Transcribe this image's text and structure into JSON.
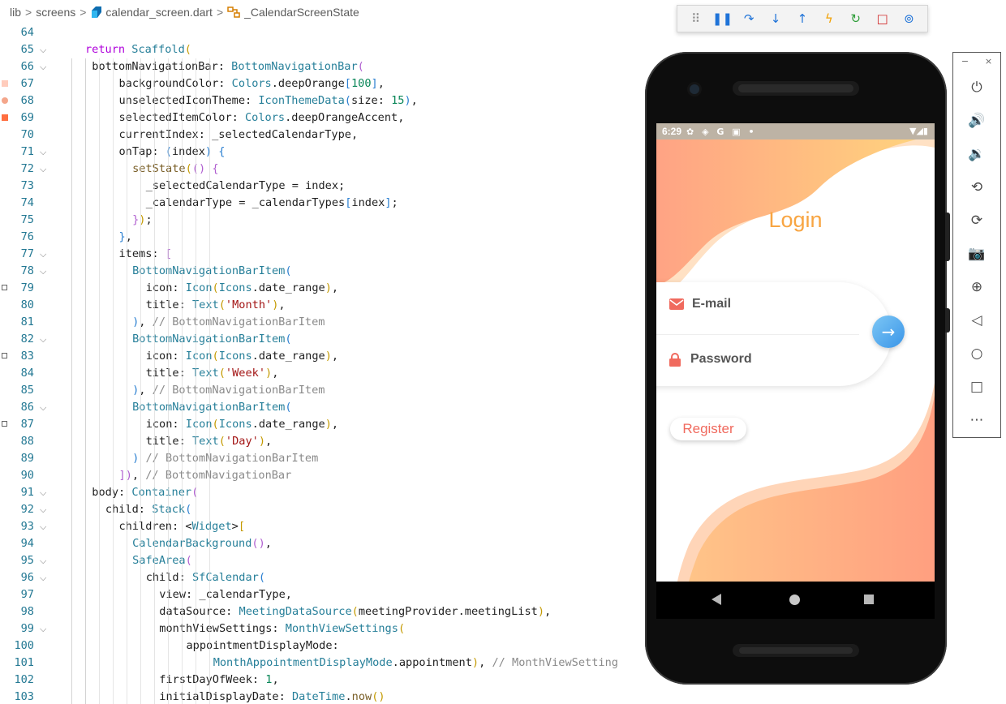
{
  "breadcrumb": {
    "items": [
      "lib",
      "screens",
      "calendar_screen.dart",
      "_CalendarScreenState"
    ],
    "separator": ">"
  },
  "debug_toolbar": {
    "buttons": [
      {
        "name": "drag-handle-icon",
        "glyph": "⠿",
        "color": "#8a8a8a"
      },
      {
        "name": "pause-icon",
        "glyph": "❚❚",
        "color": "#1f73d8"
      },
      {
        "name": "step-over-icon",
        "glyph": "↷",
        "color": "#1f73d8"
      },
      {
        "name": "step-into-icon",
        "glyph": "↓",
        "color": "#1f73d8"
      },
      {
        "name": "step-out-icon",
        "glyph": "↑",
        "color": "#1f73d8"
      },
      {
        "name": "hot-reload-icon",
        "glyph": "ϟ",
        "color": "#f2a000"
      },
      {
        "name": "restart-icon",
        "glyph": "↻",
        "color": "#2e9e39"
      },
      {
        "name": "stop-icon",
        "glyph": "□",
        "color": "#d12a2a"
      },
      {
        "name": "devtools-icon",
        "glyph": "⊚",
        "color": "#1f73d8"
      }
    ]
  },
  "editor": {
    "lines": [
      {
        "n": "64",
        "fold": false,
        "indent": 0,
        "parts": []
      },
      {
        "n": "65",
        "fold": true,
        "indent": 1,
        "parts": [
          [
            "kw",
            "return "
          ],
          [
            "ty",
            "Scaffold"
          ],
          [
            "p1",
            "("
          ]
        ]
      },
      {
        "n": "66",
        "fold": true,
        "indent": 1.5,
        "parts": [
          [
            "id",
            "bottomNavigationBar: "
          ],
          [
            "ty",
            "BottomNavigationBar"
          ],
          [
            "p2",
            "("
          ]
        ]
      },
      {
        "n": "67",
        "fold": false,
        "indent": 3.5,
        "mark": "color",
        "parts": [
          [
            "id",
            "backgroundColor: "
          ],
          [
            "ty",
            "Colors"
          ],
          [
            "id",
            ".deepOrange"
          ],
          [
            "p3",
            "["
          ],
          [
            "num",
            "100"
          ],
          [
            "p3",
            "]"
          ],
          [
            "id",
            ","
          ]
        ]
      },
      {
        "n": "68",
        "fold": false,
        "indent": 3.5,
        "mark": "dot",
        "parts": [
          [
            "id",
            "unselectedIconTheme: "
          ],
          [
            "ty",
            "IconThemeData"
          ],
          [
            "p3",
            "("
          ],
          [
            "id",
            "size: "
          ],
          [
            "num",
            "15"
          ],
          [
            "p3",
            ")"
          ],
          [
            "id",
            ","
          ]
        ]
      },
      {
        "n": "69",
        "fold": false,
        "indent": 3.5,
        "mark": "square",
        "parts": [
          [
            "id",
            "selectedItemColor: "
          ],
          [
            "ty",
            "Colors"
          ],
          [
            "id",
            ".deepOrangeAccent,"
          ]
        ]
      },
      {
        "n": "70",
        "fold": false,
        "indent": 3.5,
        "parts": [
          [
            "id",
            "currentIndex: _selectedCalendarType,"
          ]
        ]
      },
      {
        "n": "71",
        "fold": true,
        "indent": 3.5,
        "parts": [
          [
            "id",
            "onTap: "
          ],
          [
            "p3",
            "("
          ],
          [
            "id",
            "index"
          ],
          [
            "p3",
            ")"
          ],
          [
            "id",
            " "
          ],
          [
            "p3",
            "{"
          ]
        ]
      },
      {
        "n": "72",
        "fold": true,
        "indent": 4.5,
        "parts": [
          [
            "fn",
            "setState"
          ],
          [
            "p1",
            "("
          ],
          [
            "p2",
            "()"
          ],
          [
            "id",
            " "
          ],
          [
            "p2",
            "{"
          ]
        ]
      },
      {
        "n": "73",
        "fold": false,
        "indent": 5.5,
        "parts": [
          [
            "id",
            "_selectedCalendarType = index;"
          ]
        ]
      },
      {
        "n": "74",
        "fold": false,
        "indent": 5.5,
        "parts": [
          [
            "id",
            "_calendarType = _calendarTypes"
          ],
          [
            "p3",
            "["
          ],
          [
            "id",
            "index"
          ],
          [
            "p3",
            "]"
          ],
          [
            "id",
            ";"
          ]
        ]
      },
      {
        "n": "75",
        "fold": false,
        "indent": 4.5,
        "parts": [
          [
            "p2",
            "}"
          ],
          [
            "p1",
            ")"
          ],
          [
            "id",
            ";"
          ]
        ]
      },
      {
        "n": "76",
        "fold": false,
        "indent": 3.5,
        "parts": [
          [
            "p3",
            "}"
          ],
          [
            "id",
            ","
          ]
        ]
      },
      {
        "n": "77",
        "fold": true,
        "indent": 3.5,
        "parts": [
          [
            "id",
            "items: "
          ],
          [
            "p2",
            "["
          ]
        ]
      },
      {
        "n": "78",
        "fold": true,
        "indent": 4.5,
        "parts": [
          [
            "ty",
            "BottomNavigationBarItem"
          ],
          [
            "p3",
            "("
          ]
        ]
      },
      {
        "n": "79",
        "fold": false,
        "indent": 5.5,
        "mark": "cal",
        "parts": [
          [
            "id",
            "icon: "
          ],
          [
            "ty",
            "Icon"
          ],
          [
            "p1",
            "("
          ],
          [
            "ty",
            "Icons"
          ],
          [
            "id",
            ".date_range"
          ],
          [
            "p1",
            ")"
          ],
          [
            "id",
            ","
          ]
        ]
      },
      {
        "n": "80",
        "fold": false,
        "indent": 5.5,
        "parts": [
          [
            "id",
            "title: "
          ],
          [
            "ty",
            "Text"
          ],
          [
            "p1",
            "("
          ],
          [
            "str",
            "'Month'"
          ],
          [
            "p1",
            ")"
          ],
          [
            "id",
            ","
          ]
        ]
      },
      {
        "n": "81",
        "fold": false,
        "indent": 4.5,
        "parts": [
          [
            "p3",
            ")"
          ],
          [
            "id",
            ", "
          ],
          [
            "cm",
            "// BottomNavigationBarItem"
          ]
        ]
      },
      {
        "n": "82",
        "fold": true,
        "indent": 4.5,
        "parts": [
          [
            "ty",
            "BottomNavigationBarItem"
          ],
          [
            "p3",
            "("
          ]
        ]
      },
      {
        "n": "83",
        "fold": false,
        "indent": 5.5,
        "mark": "cal",
        "parts": [
          [
            "id",
            "icon: "
          ],
          [
            "ty",
            "Icon"
          ],
          [
            "p1",
            "("
          ],
          [
            "ty",
            "Icons"
          ],
          [
            "id",
            ".date_range"
          ],
          [
            "p1",
            ")"
          ],
          [
            "id",
            ","
          ]
        ]
      },
      {
        "n": "84",
        "fold": false,
        "indent": 5.5,
        "parts": [
          [
            "id",
            "title: "
          ],
          [
            "ty",
            "Text"
          ],
          [
            "p1",
            "("
          ],
          [
            "str",
            "'Week'"
          ],
          [
            "p1",
            ")"
          ],
          [
            "id",
            ","
          ]
        ]
      },
      {
        "n": "85",
        "fold": false,
        "indent": 4.5,
        "parts": [
          [
            "p3",
            ")"
          ],
          [
            "id",
            ", "
          ],
          [
            "cm",
            "// BottomNavigationBarItem"
          ]
        ]
      },
      {
        "n": "86",
        "fold": true,
        "indent": 4.5,
        "parts": [
          [
            "ty",
            "BottomNavigationBarItem"
          ],
          [
            "p3",
            "("
          ]
        ]
      },
      {
        "n": "87",
        "fold": false,
        "indent": 5.5,
        "mark": "cal",
        "parts": [
          [
            "id",
            "icon: "
          ],
          [
            "ty",
            "Icon"
          ],
          [
            "p1",
            "("
          ],
          [
            "ty",
            "Icons"
          ],
          [
            "id",
            ".date_range"
          ],
          [
            "p1",
            ")"
          ],
          [
            "id",
            ","
          ]
        ]
      },
      {
        "n": "88",
        "fold": false,
        "indent": 5.5,
        "parts": [
          [
            "id",
            "title: "
          ],
          [
            "ty",
            "Text"
          ],
          [
            "p1",
            "("
          ],
          [
            "str",
            "'Day'"
          ],
          [
            "p1",
            ")"
          ],
          [
            "id",
            ","
          ]
        ]
      },
      {
        "n": "89",
        "fold": false,
        "indent": 4.5,
        "parts": [
          [
            "p3",
            ")"
          ],
          [
            "id",
            " "
          ],
          [
            "cm",
            "// BottomNavigationBarItem"
          ]
        ]
      },
      {
        "n": "90",
        "fold": false,
        "indent": 3.5,
        "parts": [
          [
            "p2",
            "]"
          ],
          [
            "p2",
            ")"
          ],
          [
            "id",
            ", "
          ],
          [
            "cm",
            "// BottomNavigationBar"
          ]
        ]
      },
      {
        "n": "91",
        "fold": true,
        "indent": 1.5,
        "parts": [
          [
            "id",
            "body: "
          ],
          [
            "ty",
            "Container"
          ],
          [
            "p2",
            "("
          ]
        ]
      },
      {
        "n": "92",
        "fold": true,
        "indent": 2.5,
        "parts": [
          [
            "id",
            "child: "
          ],
          [
            "ty",
            "Stack"
          ],
          [
            "p3",
            "("
          ]
        ]
      },
      {
        "n": "93",
        "fold": true,
        "indent": 3.5,
        "parts": [
          [
            "id",
            "children: <"
          ],
          [
            "ty",
            "Widget"
          ],
          [
            "id",
            ">"
          ],
          [
            "p1",
            "["
          ]
        ]
      },
      {
        "n": "94",
        "fold": false,
        "indent": 4.5,
        "parts": [
          [
            "ty",
            "CalendarBackground"
          ],
          [
            "p2",
            "()"
          ],
          [
            "id",
            ","
          ]
        ]
      },
      {
        "n": "95",
        "fold": true,
        "indent": 4.5,
        "parts": [
          [
            "ty",
            "SafeArea"
          ],
          [
            "p2",
            "("
          ]
        ]
      },
      {
        "n": "96",
        "fold": true,
        "indent": 5.5,
        "parts": [
          [
            "id",
            "child: "
          ],
          [
            "ty",
            "SfCalendar"
          ],
          [
            "p3",
            "("
          ]
        ]
      },
      {
        "n": "97",
        "fold": false,
        "indent": 6.5,
        "parts": [
          [
            "id",
            "view: _calendarType,"
          ]
        ]
      },
      {
        "n": "98",
        "fold": false,
        "indent": 6.5,
        "parts": [
          [
            "id",
            "dataSource: "
          ],
          [
            "ty",
            "MeetingDataSource"
          ],
          [
            "p1",
            "("
          ],
          [
            "id",
            "meetingProvider.meetingList"
          ],
          [
            "p1",
            ")"
          ],
          [
            "id",
            ","
          ]
        ]
      },
      {
        "n": "99",
        "fold": true,
        "indent": 6.5,
        "parts": [
          [
            "id",
            "monthViewSettings: "
          ],
          [
            "ty",
            "MonthViewSettings"
          ],
          [
            "p1",
            "("
          ]
        ]
      },
      {
        "n": "100",
        "fold": false,
        "indent": 8.5,
        "parts": [
          [
            "id",
            "appointmentDisplayMode:"
          ]
        ]
      },
      {
        "n": "101",
        "fold": false,
        "indent": 10.5,
        "parts": [
          [
            "ty",
            "MonthAppointmentDisplayMode"
          ],
          [
            "id",
            ".appointment"
          ],
          [
            "p1",
            ")"
          ],
          [
            "id",
            ", "
          ],
          [
            "cm",
            "// MonthViewSetting"
          ]
        ]
      },
      {
        "n": "102",
        "fold": false,
        "indent": 6.5,
        "parts": [
          [
            "id",
            "firstDayOfWeek: "
          ],
          [
            "num",
            "1"
          ],
          [
            "id",
            ","
          ]
        ]
      },
      {
        "n": "103",
        "fold": false,
        "indent": 6.5,
        "parts": [
          [
            "id",
            "initialDisplayDate: "
          ],
          [
            "ty",
            "DateTime"
          ],
          [
            "id",
            "."
          ],
          [
            "fn",
            "now"
          ],
          [
            "p1",
            "()"
          ]
        ]
      }
    ]
  },
  "phone": {
    "status": {
      "time": "6:29",
      "icons": "✿ ◈ G ▣ •",
      "right": "▼◢▮"
    },
    "login_title": "Login",
    "email_label": "E-mail",
    "password_label": "Password",
    "register_label": "Register",
    "colors": {
      "accent": "#f8a542",
      "wave_start": "#ffa07a",
      "wave_end": "#ffd27a",
      "icon_red": "#f06a5e",
      "button_blue": "#3a95e8"
    }
  },
  "emulator_panel": {
    "window_controls": [
      "−",
      "×"
    ],
    "buttons": [
      {
        "name": "power-icon",
        "glyph": "⏻"
      },
      {
        "name": "volume-up-icon",
        "glyph": "🔊"
      },
      {
        "name": "volume-down-icon",
        "glyph": "🔉"
      },
      {
        "name": "rotate-left-icon",
        "glyph": "⟲"
      },
      {
        "name": "rotate-right-icon",
        "glyph": "⟳"
      },
      {
        "name": "camera-icon",
        "glyph": "📷"
      },
      {
        "name": "zoom-icon",
        "glyph": "⊕"
      },
      {
        "name": "back-icon",
        "glyph": "◁"
      },
      {
        "name": "home-icon",
        "glyph": "○"
      },
      {
        "name": "overview-icon",
        "glyph": "□"
      },
      {
        "name": "more-icon",
        "glyph": "⋯"
      }
    ]
  }
}
